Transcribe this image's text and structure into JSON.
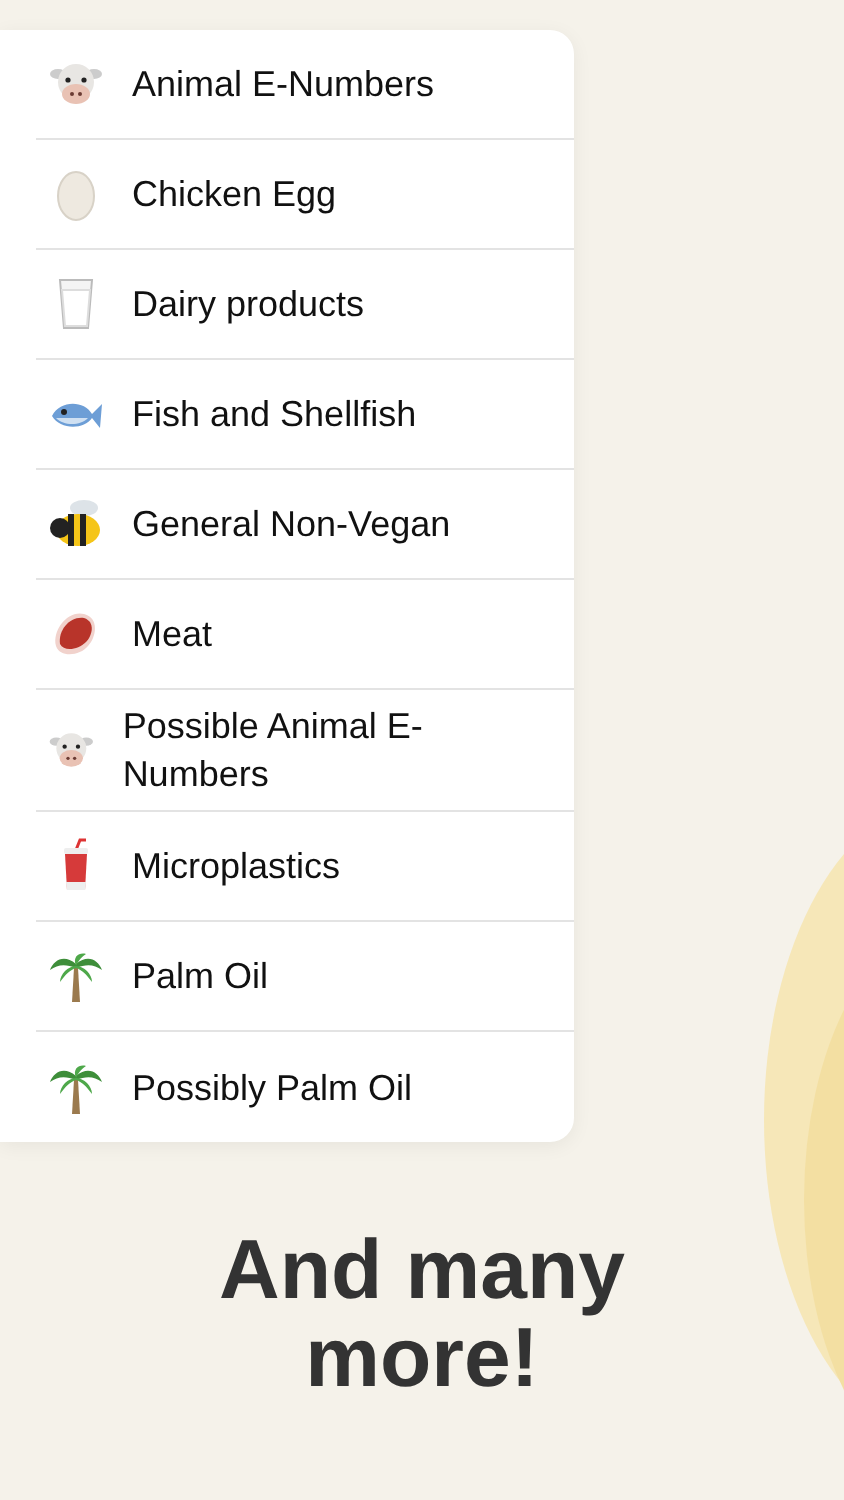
{
  "categories": [
    {
      "kind": "cow",
      "label": "Animal E-Numbers"
    },
    {
      "kind": "egg",
      "label": "Chicken Egg"
    },
    {
      "kind": "milk",
      "label": "Dairy products"
    },
    {
      "kind": "fish",
      "label": "Fish and Shellfish"
    },
    {
      "kind": "bee",
      "label": "General Non-Vegan"
    },
    {
      "kind": "meat",
      "label": "Meat"
    },
    {
      "kind": "cow",
      "label": "Possible Animal E-Numbers"
    },
    {
      "kind": "cup",
      "label": "Microplastics"
    },
    {
      "kind": "palm",
      "label": "Palm Oil"
    },
    {
      "kind": "palm",
      "label": "Possibly Palm Oil"
    }
  ],
  "headline": "And many more!"
}
